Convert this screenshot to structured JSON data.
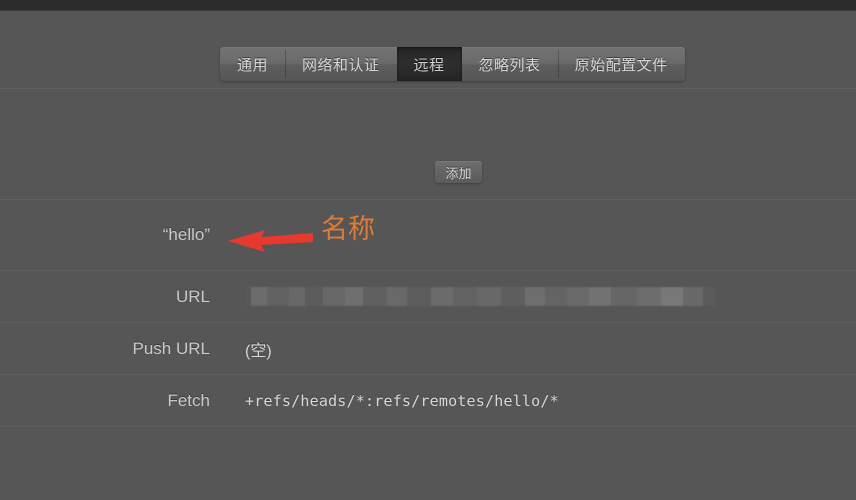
{
  "window": {
    "titlebar_color": "#2c2c2c",
    "body_color": "#565656"
  },
  "tabs": {
    "items": [
      {
        "label": "通用",
        "selected": false
      },
      {
        "label": "网络和认证",
        "selected": false
      },
      {
        "label": "远程",
        "selected": true
      },
      {
        "label": "忽略列表",
        "selected": false
      },
      {
        "label": "原始配置文件",
        "selected": false
      }
    ]
  },
  "toolbar": {
    "add_label": "添加"
  },
  "details": {
    "rows": [
      {
        "label": "“hello”",
        "value": "",
        "type": "name"
      },
      {
        "label": "URL",
        "value": "",
        "type": "redacted"
      },
      {
        "label": "Push URL",
        "value": "(空)",
        "type": "text"
      },
      {
        "label": "Fetch",
        "value": "+refs/heads/*:refs/remotes/hello/*",
        "type": "mono"
      }
    ]
  },
  "annotation": {
    "text": "名称",
    "arrow_color": "#e8392e",
    "text_color": "#e07b33",
    "arrow_direction": "left"
  }
}
